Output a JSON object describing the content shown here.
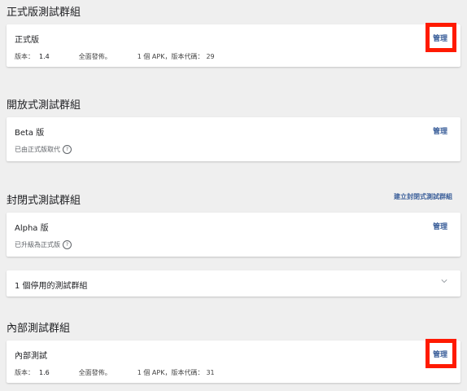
{
  "production": {
    "section_title": "正式版測試群組",
    "card_title": "正式版",
    "manage_label": "管理",
    "version_label": "版本：",
    "version_value": "1.4",
    "rollout": "全面發佈。",
    "apk_info": "1 個 APK，版本代碼：",
    "version_code": "29"
  },
  "open_testing": {
    "section_title": "開放式測試群組",
    "card_title": "Beta 版",
    "manage_label": "管理",
    "status": "已由正式版取代"
  },
  "closed_testing": {
    "section_title": "封閉式測試群組",
    "create_label": "建立封閉式測試群組",
    "card_title": "Alpha 版",
    "manage_label": "管理",
    "status": "已升級為正式版",
    "inactive_label": "1 個停用的測試群組"
  },
  "internal_testing": {
    "section_title": "內部測試群組",
    "card_title": "內部測試",
    "manage_label": "管理",
    "version_label": "版本：",
    "version_value": "1.6",
    "rollout": "全面發佈。",
    "apk_info": "1 個 APK，版本代碼：",
    "version_code": "31"
  },
  "icons": {
    "help": "help-circle-icon",
    "chevron": "chevron-down-icon"
  },
  "colors": {
    "link": "#3b5f9a",
    "highlight": "#ff1a00",
    "background": "#efefef"
  }
}
